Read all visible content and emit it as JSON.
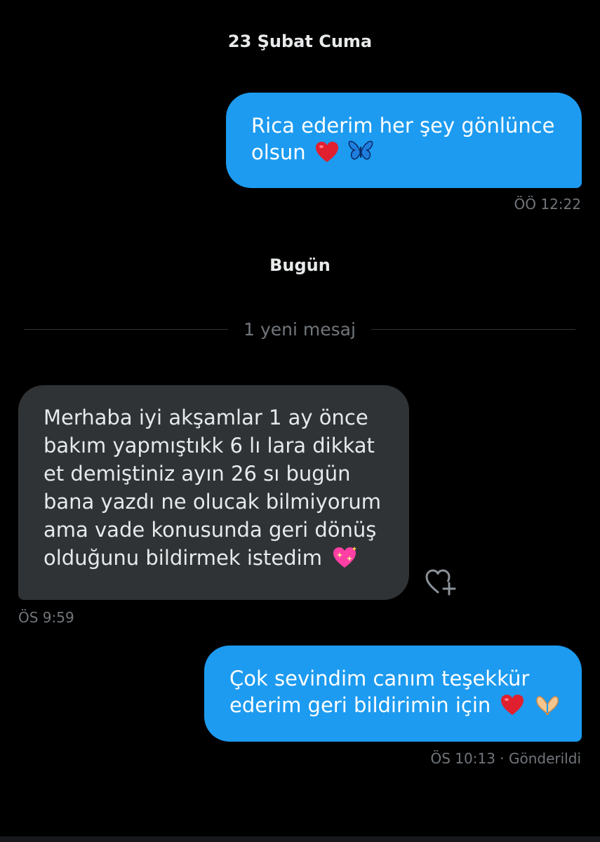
{
  "conversation": {
    "date_separator_1": "23 Şubat Cuma",
    "date_separator_2": "Bugün",
    "new_messages_divider": "1 yeni mesaj",
    "messages": [
      {
        "direction": "outgoing",
        "lines": [
          "Rica ederim her şey gönlünce",
          "olsun"
        ],
        "emojis": [
          "red-heart",
          "blue-butterfly"
        ],
        "time": "ÖÖ 12:22"
      },
      {
        "direction": "incoming",
        "lines": [
          "Merhaba iyi akşamlar 1 ay önce",
          "bakım yapmıştıkk 6 lı lara dikkat",
          "et demiştiniz ayın 26 sı bugün",
          "bana yazdı ne olucak bilmiyorum",
          "ama vade konusunda geri dönüş",
          "olduğunu bildirmek istedim"
        ],
        "emojis": [
          "sparkling-heart"
        ],
        "time": "ÖS 9:59"
      },
      {
        "direction": "outgoing",
        "lines": [
          "Çok sevindim canım teşekkür",
          "ederim geri bildirimin için"
        ],
        "emojis": [
          "red-heart",
          "heart-hands"
        ],
        "time": "ÖS 10:13",
        "status": "· Gönderildi"
      }
    ]
  },
  "colors": {
    "background": "#000000",
    "outgoing_bubble": "#1d9bf0",
    "incoming_bubble": "#2f3336",
    "muted_text": "#71767b"
  },
  "icons": {
    "react": "heart-plus-icon"
  }
}
